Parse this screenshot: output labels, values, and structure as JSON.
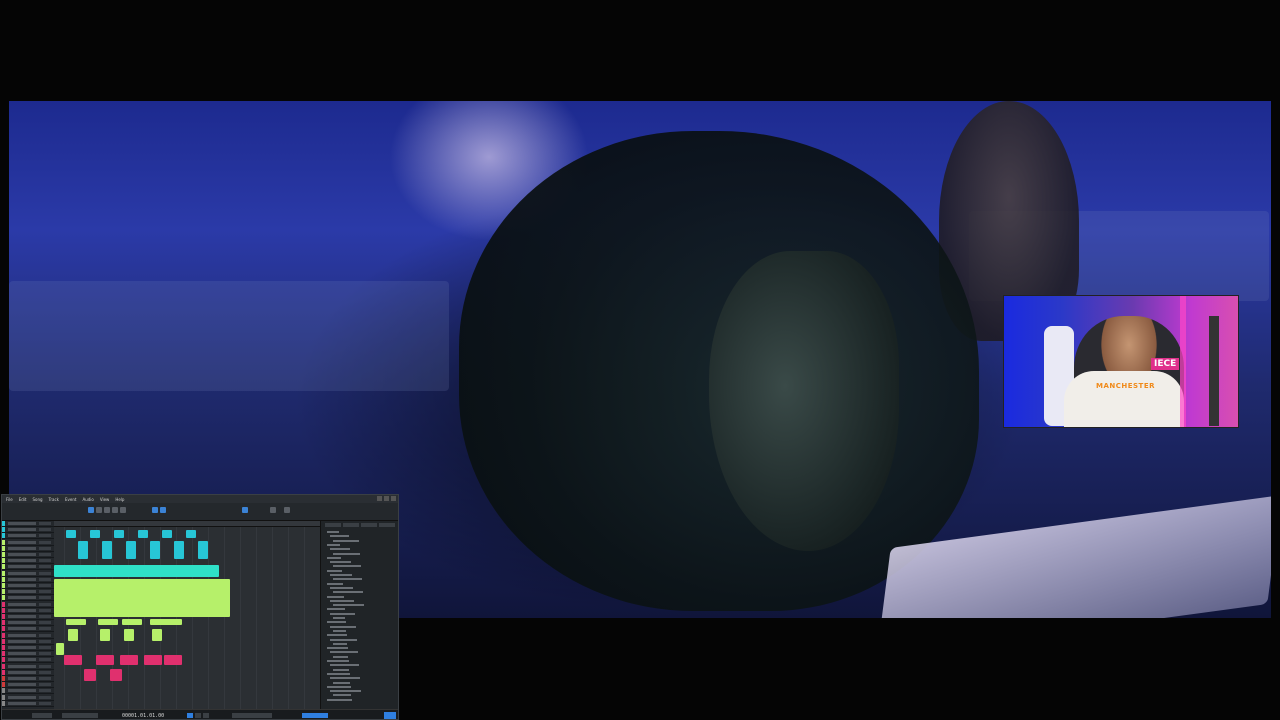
{
  "video": {
    "description_colors": {
      "primary": "#2b3aa8",
      "shadow": "#0c1416"
    }
  },
  "webcam": {
    "shirt_text": "MANCHESTER",
    "sign_text": "IECE"
  },
  "daw": {
    "menu": [
      "File",
      "Edit",
      "Song",
      "Track",
      "Event",
      "Audio",
      "View",
      "Help"
    ],
    "transport_time": "00001.01.01.00",
    "colors": {
      "accent": "#3b83d6",
      "clip_cyan": "#27c6d6",
      "clip_green": "#b6f06a",
      "clip_pink": "#e0306e"
    }
  }
}
